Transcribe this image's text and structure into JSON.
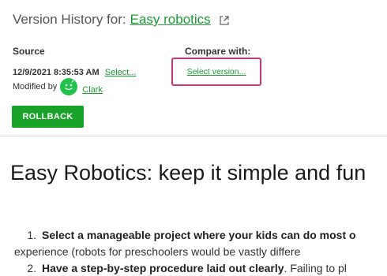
{
  "header": {
    "prefix": "Version History for:",
    "page_name": "Easy robotics",
    "external_icon": "external-link-icon"
  },
  "source": {
    "label": "Source",
    "timestamp": "12/9/2021 8:35:53 AM",
    "select_link": "Select...",
    "modified_by_label": "Modified by",
    "avatar_icon": "user-avatar-icon",
    "author": "Clark"
  },
  "compare": {
    "label": "Compare with:",
    "select_link": "Select version..."
  },
  "actions": {
    "rollback_label": "ROLLBACK"
  },
  "document": {
    "title": "Easy Robotics: keep it simple and fun",
    "items": [
      {
        "number": "1.",
        "bold": "Select a manageable project where your kids can do most o",
        "rest": "",
        "continuation": "experience (robots for preschoolers would be vastly differe"
      },
      {
        "number": "2.",
        "bold": "Have a step-by-step procedure laid out clearly",
        "rest": ". Failing to pl",
        "continuation": ""
      }
    ]
  },
  "colors": {
    "accent_green": "#18a228",
    "link_green": "#1a9c32",
    "highlight_border": "#d6336c",
    "avatar_green": "#1fc24a"
  }
}
